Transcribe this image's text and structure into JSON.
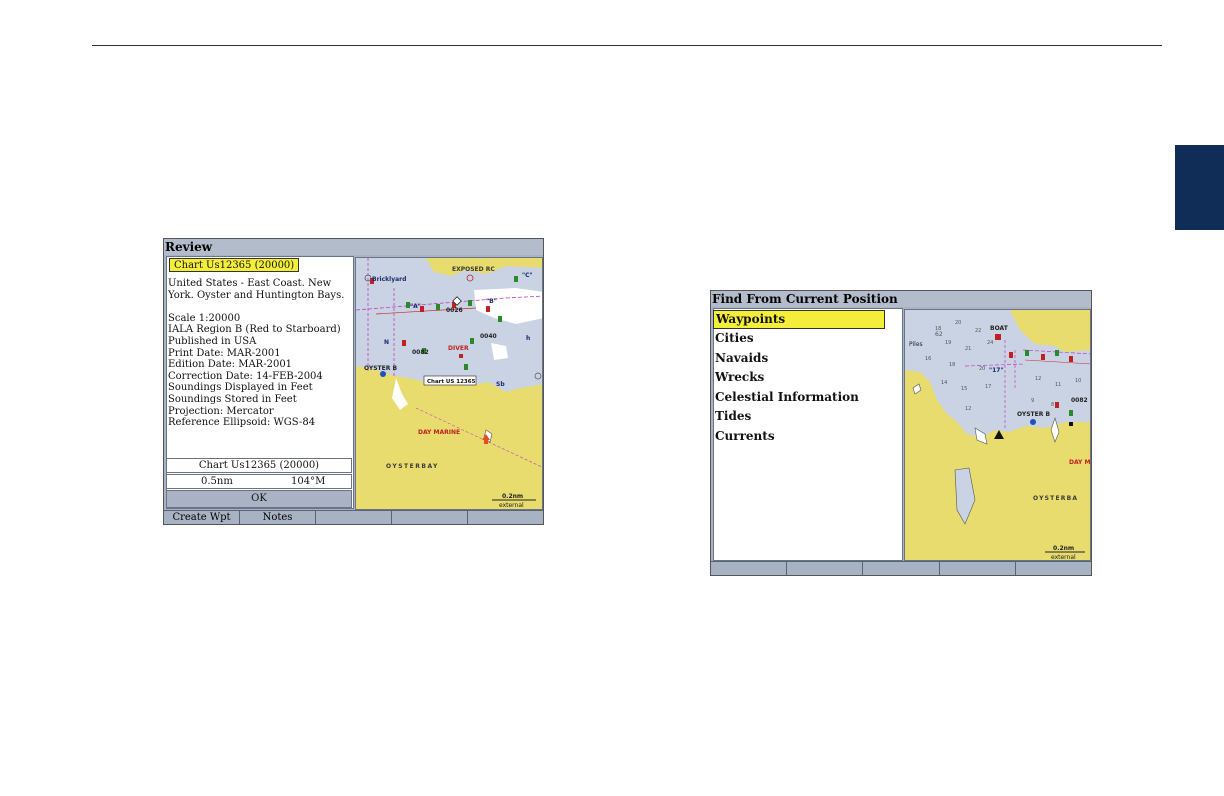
{
  "review": {
    "title": "Review",
    "chart_name_highlight": "Chart Us12365 (20000)",
    "info_lines": [
      "United States - East Coast. New",
      "York. Oyster and Huntington Bays.",
      "",
      "Scale 1:20000",
      "IALA Region B (Red to Starboard)",
      "Published in USA",
      "Print Date: MAR-2001",
      "Edition Date: MAR-2001",
      "Correction Date: 14-FEB-2004",
      "Soundings Displayed in Feet",
      "Soundings Stored in Feet",
      "Projection: Mercator",
      "Reference Ellipsoid: WGS-84"
    ],
    "chart_name_row": "Chart Us12365 (20000)",
    "distance": "0.5nm",
    "bearing": "104°M",
    "ok_label": "OK",
    "softkeys": [
      "Create Wpt",
      "Notes",
      "",
      "",
      ""
    ],
    "map": {
      "labels": {
        "bricklyard": "Bricklyard",
        "exposed": "EXPOSED RC",
        "c_label": "\"C\"",
        "a_label": "\"A\"",
        "b_label": "\"B\"",
        "n_label": "N",
        "num_0026": "0026",
        "num_0040": "0040",
        "num_0082": "0082",
        "diver": "DIVER",
        "oyster_b": "OYSTER B",
        "chart_callout": "Chart US 12365",
        "sb": "Sb",
        "day_marine": "DAY MARINE",
        "oysterbay": "OYSTERBAY",
        "scale": "0.2nm",
        "external": "external",
        "h_label": "h"
      }
    }
  },
  "find": {
    "title": "Find From Current Position",
    "items": [
      "Waypoints",
      "Cities",
      "Navaids",
      "Wrecks",
      "Celestial Information",
      "Tides",
      "Currents"
    ],
    "selected_index": 0,
    "softkeys": [
      "",
      "",
      "",
      "",
      ""
    ],
    "map": {
      "labels": {
        "boat": "BOAT",
        "piles": "Piles",
        "num_17": "\"17\"",
        "num_0082": "0082",
        "oyster_b": "OYSTER B",
        "day_m": "DAY M",
        "oysterba": "OYSTERBA",
        "scale": "0.2nm",
        "external": "external",
        "num_62": "62"
      }
    }
  },
  "colors": {
    "land": "#e8dc6e",
    "water": "#c9d3e3",
    "highlight": "#f2ee3a",
    "nav_tab": "#0f2d57"
  }
}
